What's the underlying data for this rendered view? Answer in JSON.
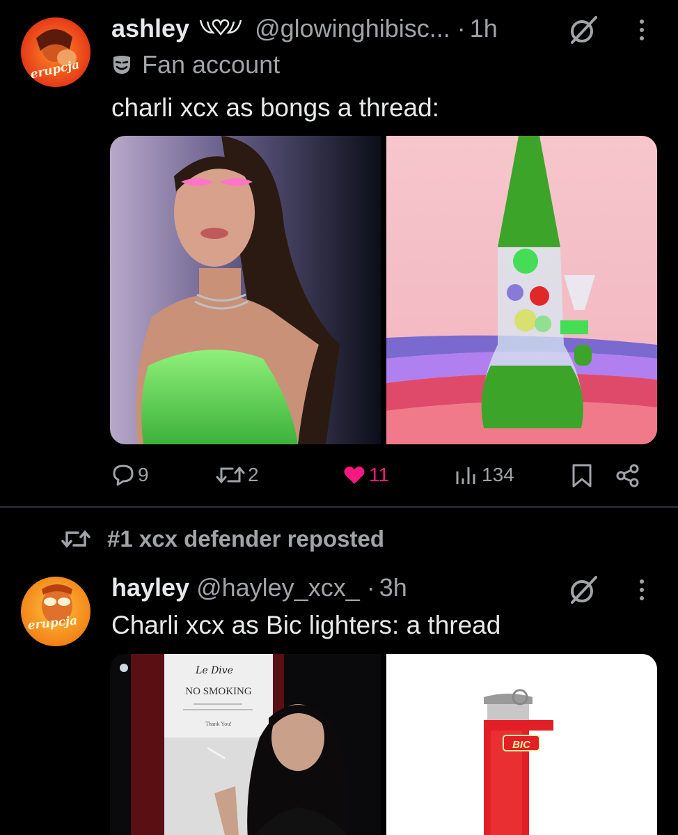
{
  "post1": {
    "author_name": "ashley",
    "author_badge": "ʚ♡ɞ",
    "author_handle": "@glowinghibisc...",
    "separator": "·",
    "time": "1h",
    "label": "Fan account",
    "text": "charli xcx as bongs a thread:",
    "replies": "9",
    "reposts": "2",
    "likes": "11",
    "views": "134",
    "accent_like_color": "#f91880"
  },
  "post2": {
    "reposted_by": "#1 xcx defender reposted",
    "author_name": "hayley",
    "author_handle": "@hayley_xcx_",
    "separator": "·",
    "time": "3h",
    "text": "Charli xcx as Bic lighters: a thread",
    "sign_line1": "Le Dive",
    "sign_line2": "NO SMOKING",
    "sign_line3": "Thank You!",
    "lighter_brand": "BIC"
  },
  "avatar_text": "erupcja",
  "icons": [
    "grok-icon",
    "more-icon",
    "mask-icon",
    "reply-icon",
    "repost-icon",
    "heart-icon",
    "views-icon",
    "bookmark-icon",
    "share-icon"
  ]
}
